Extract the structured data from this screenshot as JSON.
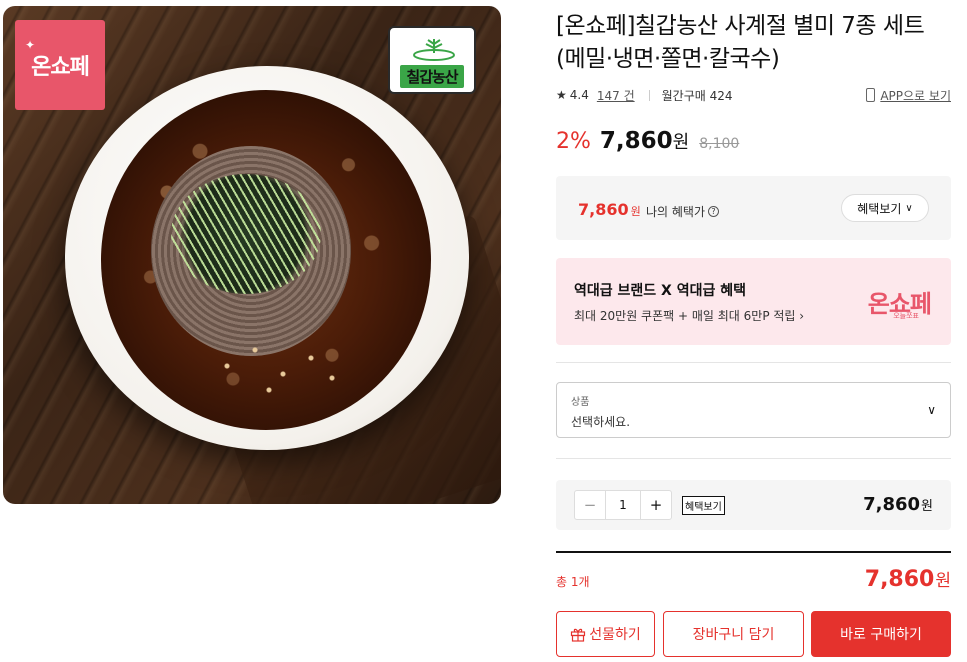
{
  "image": {
    "badge_left": "온쇼페",
    "badge_brand": "칠갑농산"
  },
  "product": {
    "title": "[온쇼페]칠갑농산 사계절 별미 7종 세트 (메밀·냉면·쫄면·칼국수)",
    "rating": "4.4",
    "review_count": "147 건",
    "monthly_sales": "월간구매 424",
    "app_link": "APP으로 보기",
    "discount_rate": "2%",
    "price": "7,860",
    "price_unit": "원",
    "original_price": "8,100"
  },
  "benefit": {
    "price": "7,860",
    "unit": "원",
    "label": "나의 혜택가",
    "button": "혜택보기"
  },
  "promo": {
    "title": "역대급 브랜드 X 역대급 혜택",
    "subtitle": "최대 20만원 쿠폰팩 + 매일 최대 6만P 적립",
    "logo": "온쇼페",
    "logo_sub": "오늘쪼표"
  },
  "option": {
    "label": "상품",
    "placeholder": "선택하세요."
  },
  "quantity": {
    "value": "1",
    "minus": "−",
    "plus": "+",
    "benefit_tag": "혜택보기",
    "price": "7,860",
    "unit": "원"
  },
  "total": {
    "label": "총 1개",
    "price": "7,860",
    "unit": "원"
  },
  "buttons": {
    "gift": "선물하기",
    "cart": "장바구니 담기",
    "buy": "바로 구매하기"
  },
  "colors": {
    "accent": "#e5322d",
    "brand_pink": "#e8566a",
    "promo_bg": "#fde8ec"
  },
  "icons": {
    "star": "star-icon",
    "phone": "phone-icon",
    "question": "question-icon",
    "chevron": "chevron-down-icon",
    "gift": "gift-icon"
  }
}
